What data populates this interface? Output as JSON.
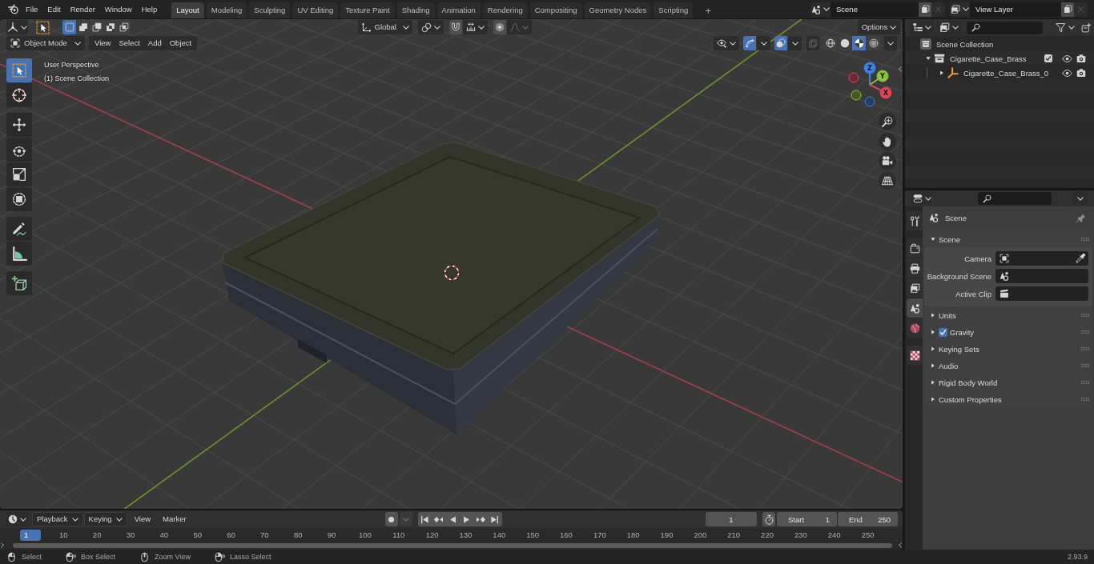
{
  "top_bar": {
    "menus": [
      "File",
      "Edit",
      "Render",
      "Window",
      "Help"
    ],
    "workspaces": [
      {
        "label": "Layout",
        "selected": true
      },
      {
        "label": "Modeling",
        "selected": false
      },
      {
        "label": "Sculpting",
        "selected": false
      },
      {
        "label": "UV Editing",
        "selected": false
      },
      {
        "label": "Texture Paint",
        "selected": false
      },
      {
        "label": "Shading",
        "selected": false
      },
      {
        "label": "Animation",
        "selected": false
      },
      {
        "label": "Rendering",
        "selected": false
      },
      {
        "label": "Compositing",
        "selected": false
      },
      {
        "label": "Geometry Nodes",
        "selected": false
      },
      {
        "label": "Scripting",
        "selected": false
      }
    ],
    "add_workspace": "+",
    "scene": "Scene",
    "view_layer": "View Layer"
  },
  "viewport": {
    "header": {
      "select_modes": [
        {
          "kind": "new",
          "selected": true
        },
        {
          "kind": "extend",
          "selected": false
        },
        {
          "kind": "subtract",
          "selected": false
        },
        {
          "kind": "invert",
          "selected": false
        },
        {
          "kind": "intersect",
          "selected": false
        }
      ],
      "orientation": "Global",
      "snap": false,
      "proportional_editing": false,
      "options": "Options",
      "mode": "Object Mode",
      "menus": [
        "View",
        "Select",
        "Add",
        "Object"
      ],
      "gizmos": true,
      "overlays": true,
      "xray": false,
      "shading": [
        {
          "kind": "wireframe",
          "selected": false
        },
        {
          "kind": "solid",
          "selected": false
        },
        {
          "kind": "material",
          "selected": true
        },
        {
          "kind": "rendered",
          "selected": false
        }
      ]
    },
    "view_name": "User Perspective",
    "collection": "(1) Scene Collection",
    "tools": [
      [
        {
          "kind": "select_box",
          "selected": true
        },
        {
          "kind": "cursor",
          "selected": false
        }
      ],
      [
        {
          "kind": "move",
          "selected": false
        },
        {
          "kind": "rotate",
          "selected": false
        },
        {
          "kind": "scale",
          "selected": false
        },
        {
          "kind": "transform",
          "selected": false
        }
      ],
      [
        {
          "kind": "annotate",
          "selected": false
        },
        {
          "kind": "measure",
          "selected": false
        }
      ],
      [
        {
          "kind": "add_cube",
          "selected": false
        }
      ]
    ],
    "gizmo_axes": [
      "Z",
      "Y",
      "X"
    ],
    "nav_buttons": [
      {
        "kind": "zoom"
      },
      {
        "kind": "pan"
      },
      {
        "kind": "camera"
      },
      {
        "kind": "perspective"
      }
    ]
  },
  "outliner": {
    "rows": [
      {
        "label": "Scene Collection",
        "kind": "scene_collection",
        "children": [
          {
            "label": "Cigarette_Case_Brass",
            "kind": "collection",
            "expanded": true,
            "checked": true,
            "children": [
              {
                "label": "Cigarette_Case_Brass_0",
                "kind": "object",
                "expanded": false
              }
            ]
          }
        ]
      }
    ]
  },
  "properties": {
    "tabs": [
      [
        {
          "kind": "tool",
          "selected": false
        }
      ],
      [
        {
          "kind": "render",
          "selected": false
        },
        {
          "kind": "output",
          "selected": false
        },
        {
          "kind": "view_layer",
          "selected": false
        },
        {
          "kind": "scene",
          "selected": true
        },
        {
          "kind": "world",
          "selected": false
        }
      ],
      [
        {
          "kind": "texture",
          "selected": false
        }
      ]
    ],
    "context": "Scene",
    "panels": [
      {
        "title": "Scene",
        "expanded": true,
        "fields": [
          {
            "label": "Camera",
            "kind": "object"
          },
          {
            "label": "Background Scene",
            "kind": "scene"
          },
          {
            "label": "Active Clip",
            "kind": "clip"
          }
        ]
      },
      {
        "title": "Units",
        "expanded": false
      },
      {
        "title": "Gravity",
        "expanded": false,
        "toggle": {
          "checked": true
        }
      },
      {
        "title": "Keying Sets",
        "expanded": false
      },
      {
        "title": "Audio",
        "expanded": false
      },
      {
        "title": "Rigid Body World",
        "expanded": false
      },
      {
        "title": "Custom Properties",
        "expanded": false
      }
    ]
  },
  "timeline": {
    "menus": [
      {
        "label": "Playback",
        "kind": "dropdown"
      },
      {
        "label": "Keying",
        "kind": "dropdown"
      },
      {
        "label": "View",
        "kind": "menu"
      },
      {
        "label": "Marker",
        "kind": "menu"
      }
    ],
    "auto_keying": false,
    "transport": [
      {
        "kind": "jump_start"
      },
      {
        "kind": "prev_keyframe"
      },
      {
        "kind": "play_reverse"
      },
      {
        "kind": "play"
      },
      {
        "kind": "next_keyframe"
      },
      {
        "kind": "jump_end"
      }
    ],
    "current_frame": "1",
    "preview_range": false,
    "start_label": "Start",
    "start": "1",
    "end_label": "End",
    "end": "250",
    "frames": [
      {
        "label": "1",
        "selected": true
      },
      {
        "label": "10",
        "selected": false
      },
      {
        "label": "20",
        "selected": false
      },
      {
        "label": "30",
        "selected": false
      },
      {
        "label": "40",
        "selected": false
      },
      {
        "label": "50",
        "selected": false
      },
      {
        "label": "60",
        "selected": false
      },
      {
        "label": "70",
        "selected": false
      },
      {
        "label": "80",
        "selected": false
      },
      {
        "label": "90",
        "selected": false
      },
      {
        "label": "100",
        "selected": false
      },
      {
        "label": "110",
        "selected": false
      },
      {
        "label": "120",
        "selected": false
      },
      {
        "label": "130",
        "selected": false
      },
      {
        "label": "140",
        "selected": false
      },
      {
        "label": "150",
        "selected": false
      },
      {
        "label": "160",
        "selected": false
      },
      {
        "label": "170",
        "selected": false
      },
      {
        "label": "180",
        "selected": false
      },
      {
        "label": "190",
        "selected": false
      },
      {
        "label": "200",
        "selected": false
      },
      {
        "label": "210",
        "selected": false
      },
      {
        "label": "220",
        "selected": false
      },
      {
        "label": "230",
        "selected": false
      },
      {
        "label": "240",
        "selected": false
      },
      {
        "label": "250",
        "selected": false
      }
    ]
  },
  "status_bar": {
    "hints": [
      {
        "kind": "left_click",
        "label": "Select"
      },
      {
        "kind": "left_drag",
        "label": "Box Select"
      },
      {
        "kind": "middle",
        "label": "Zoom View"
      },
      {
        "kind": "right_drag",
        "label": "Lasso Select"
      }
    ],
    "version": "2.93.9"
  }
}
